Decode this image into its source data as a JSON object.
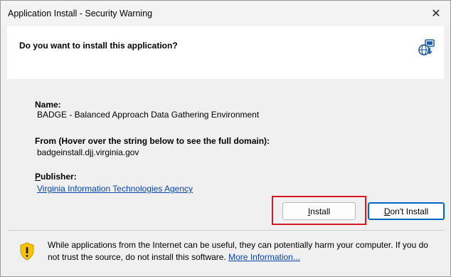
{
  "window": {
    "title": "Application Install - Security Warning",
    "close_glyph": "✕"
  },
  "header": {
    "question": "Do you want to install this application?",
    "icon": "globe-install-icon"
  },
  "details": {
    "name_label": "Name:",
    "name_value": "BADGE - Balanced Approach Data Gathering Environment",
    "from_label": "From (Hover over the string below to see the full domain):",
    "from_value": "badgeinstall.djj.virginia.gov",
    "publisher_label": "Publisher:",
    "publisher_value": "Virginia Information Technologies Agency"
  },
  "buttons": {
    "install": "Install",
    "dont_install": "Don't Install"
  },
  "footer": {
    "icon": "shield-warning-icon",
    "warning_text": "While applications from the Internet can be useful, they can potentially harm your computer. If you do not trust the source, do not install this software.",
    "more_info_link": "More Information..."
  },
  "colors": {
    "highlight": "#d71920",
    "link": "#0645ad",
    "shield": "#f5c400",
    "default_button_border": "#0067c0"
  }
}
